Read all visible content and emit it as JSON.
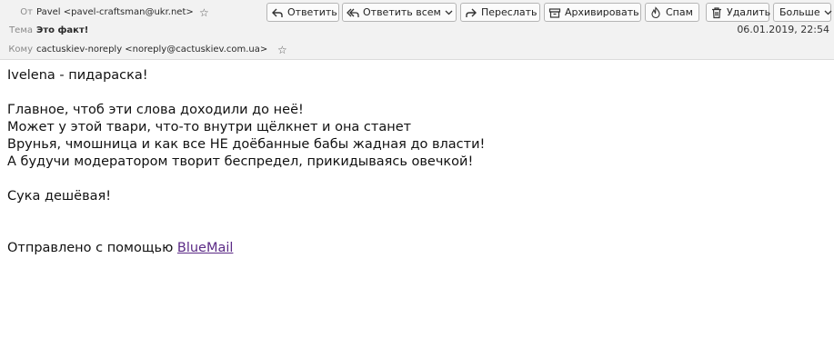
{
  "header": {
    "from_label": "От",
    "from_value": "Pavel <pavel-craftsman@ukr.net>",
    "subject_label": "Тема",
    "subject_value": "Это факт!",
    "to_label": "Кому",
    "to_value": "cactuskiev-noreply <noreply@cactuskiev.com.ua>",
    "date": "06.01.2019, 22:54"
  },
  "toolbar": {
    "reply_label": "Ответить",
    "reply_all_label": "Ответить всем",
    "forward_label": "Переслать",
    "archive_label": "Архивировать",
    "spam_label": "Спам",
    "delete_label": "Удалить",
    "more_label": "Больше"
  },
  "message": {
    "line1": "Ivelena - пидараска!",
    "line2": "Главное, чтоб эти слова доходили до неё!",
    "line3": "Может у этой твари, что-то внутри щёлкнет и она станет",
    "line4": "Врунья, чмошница и как все НЕ доёбанные бабы жадная до власти!",
    "line5": "А будучи модератором творит беспредел, прикидываясь овечкой!",
    "line6": "Сука дешёвая!",
    "signature_prefix": "Отправлено с помощью ",
    "signature_link": "BlueMail"
  },
  "icons": [
    "star-icon",
    "reply-icon",
    "reply-all-icon",
    "forward-icon",
    "archive-icon",
    "spam-icon",
    "trash-icon",
    "chevron-down-icon"
  ],
  "colors": {
    "header_bg": "#f2f2f2",
    "link": "#5b2a86",
    "label": "#8a8a8a"
  }
}
